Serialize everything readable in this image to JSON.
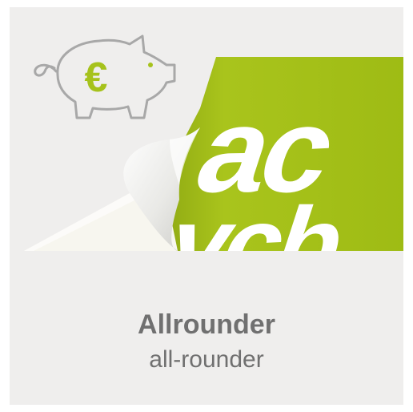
{
  "product": {
    "title": "Allrounder",
    "subtitle": "all-rounder",
    "icon": "piggy-bank-euro-icon",
    "currency_symbol": "€"
  },
  "colors": {
    "background": "#efeeed",
    "accent_green": "#a6c21c",
    "piggy_outline": "#a8a8a8",
    "text": "#707070",
    "backing_paper": "#f7f6ef"
  }
}
